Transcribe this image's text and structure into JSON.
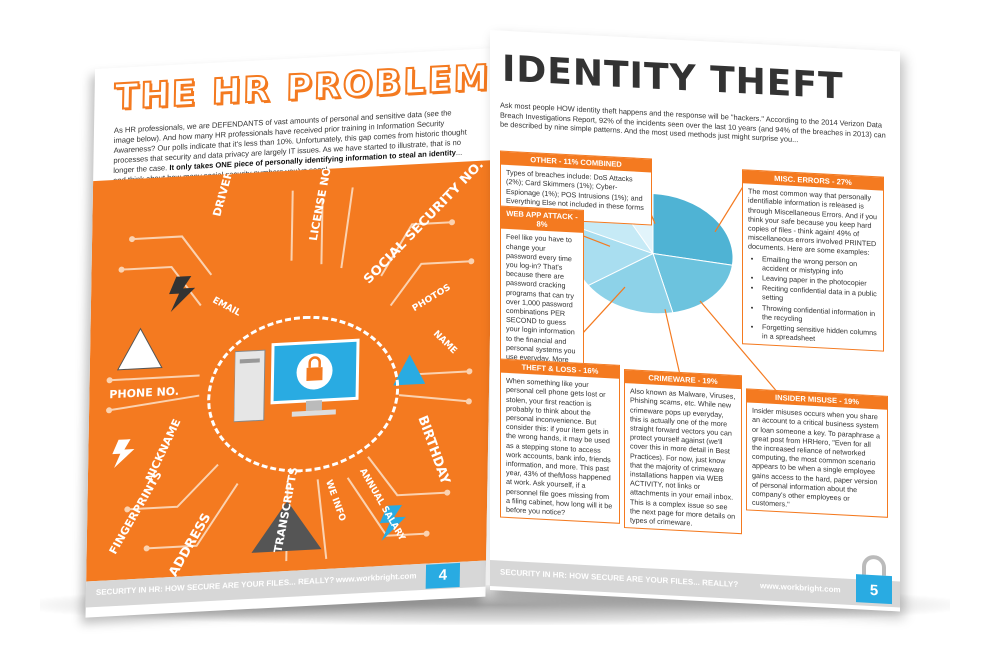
{
  "left_page": {
    "title": "THE HR PROBLEM",
    "intro_before_bold": "As HR professionals, we are DEFENDANTS of vast amounts of personal and sensitive data (see the image below). And how many HR professionals have received prior training in Information Security Awareness? Our polls indicate that it's less than 10%. Unfortunately, this gap comes from historic thought processes that security and data privacy are largely IT issues. As we have started to illustrate, that is no longer the case.",
    "intro_bold": "It only takes ONE piece of personally identifying information to steal an identity",
    "intro_after_bold": "... and think about how many social security numbers you've seen!",
    "art_labels": {
      "drivers_license": "DRIVERS LICENSE",
      "license_no": "LICENSE NO.",
      "social_security": "SOCIAL SECURITY NO.",
      "email": "EMAIL",
      "photos": "PHOTOS",
      "name": "NAME",
      "phone": "PHONE NO.",
      "nickname": "NICKNAME",
      "birthday": "BIRTHDAY",
      "we_info": "WE INFO",
      "annual_salary": "ANNUAL SALARY",
      "transcripts": "TRANSCRIPTS",
      "address": "ADDRESS",
      "fingerprints": "FINGERPRINTS"
    },
    "footer_text": "SECURITY IN HR: HOW SECURE ARE YOUR FILES... REALLY?",
    "footer_url": "www.workbright.com",
    "page_number": "4"
  },
  "right_page": {
    "title": "IDENTITY THEFT",
    "intro": "Ask most people HOW identity theft happens and the response will be \"hackers.\" According to the 2014 Verizon Data Breach Investigations Report, 92% of the incidents seen over the last 10 years (and 94% of the breaches in 2013) can be described by nine simple patterns. And the most used methods just might surprise you...",
    "boxes": {
      "other": {
        "title": "OTHER - 11% COMBINED",
        "body": "Types of breaches include: DoS Attacks (2%); Card Skimmers (1%); Cyber-Espionage (1%); POS Intrusions (1%); and Everything Else not included in these forms listed."
      },
      "webapp": {
        "title": "WEB APP ATTACK - 8%",
        "body": "Feel like you have to change your password every time you log-in? That's because there are password cracking programs that can try over 1,000 password combinations PER SECOND to guess your login information to the financial and personal systems you use everyday. More on passwords later."
      },
      "misc": {
        "title": "MISC. ERRORS - 27%",
        "body": "The most common way that personally identifiable information is released is through Miscellaneous Errors. And if you think your safe because you keep hard copies of files - think again! 49% of miscellaneous errors involved PRINTED documents. Here are some examples:",
        "items": [
          "Emailing the wrong person on accident or mistyping info",
          "Leaving paper in the photocopier",
          "Reciting confidential data in a public setting",
          "Throwing confidential information in the recycling",
          "Forgetting sensitive hidden columns in a spreadsheet"
        ]
      },
      "theft": {
        "title": "THEFT & LOSS - 16%",
        "body": "When something like your personal cell phone gets lost or stolen, your first reaction is probably to think about the personal inconvenience. But consider this: if your item gets in the wrong hands, it may be used as a stepping stone to access work accounts, bank info, friends information, and more. This past year, 43% of theft/loss happened at work. Ask yourself, if a personnel file goes missing from a filing cabinet, how long will it be before you notice?"
      },
      "crimeware": {
        "title": "CRIMEWARE - 19%",
        "body": "Also known as Malware, Viruses, Phishing scams, etc. While new crimeware pops up everyday, this is actually one of the more straight forward vectors you can protect yourself against (we'll cover this in more detail in Best Practices). For now, just know that the majority of crimeware installations happen via WEB ACTIVITY, not links or attachments in your email inbox. This is a complex issue so see the next page for more details on types of crimeware."
      },
      "insider": {
        "title": "INSIDER MISUSE - 19%",
        "body": "Insider misuses occurs when you share an account to a critical business system or loan someone a key. To paraphrase a great post from HRHero, \"Even for all the increased reliance of networked computing, the most common scenario appears to be when a single employee gains access to the hard, paper version of personal information about the company's other employees or customers.\""
      }
    },
    "footer_text": "SECURITY IN HR: HOW SECURE ARE YOUR FILES... REALLY?",
    "footer_url": "www.workbright.com",
    "page_number": "5"
  },
  "chart_data": {
    "type": "pie",
    "categories": [
      "Misc. Errors",
      "Crimeware",
      "Insider Misuse",
      "Theft & Loss",
      "Other",
      "Web App Attack"
    ],
    "values": [
      27,
      19,
      19,
      16,
      11,
      8
    ],
    "colors": [
      "#4fb3d4",
      "#6cc3de",
      "#8dd2e8",
      "#a9def0",
      "#c6eaf6",
      "#e2f4fb"
    ]
  },
  "colors": {
    "accent": "#f47a20",
    "blue": "#29abe2",
    "footer": "#d7d7d7"
  }
}
